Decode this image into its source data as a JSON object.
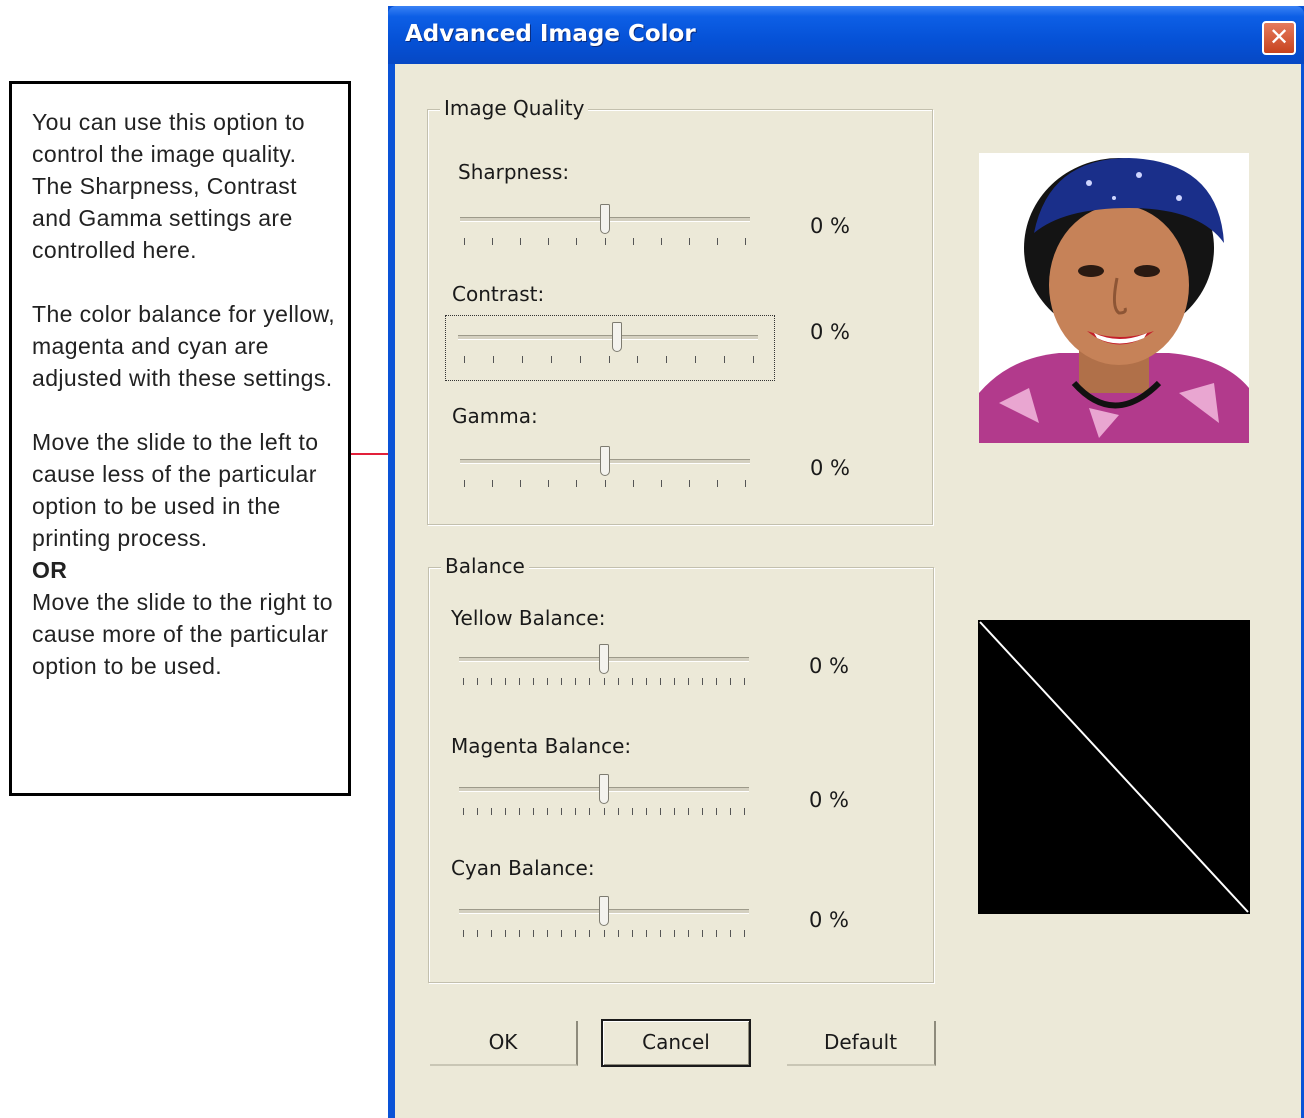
{
  "callout": {
    "para1": "You can use this option to control the image quality. The Sharpness, Contrast and Gamma settings are controlled here.",
    "para2": "The color balance for yellow, magenta and cyan are adjusted with these settings.",
    "para3": "Move the slide to the left to cause less of the particular option to be used in the printing process.",
    "or_label": "OR",
    "para4": "Move the slide to the right to cause more of the particular option to be used."
  },
  "dialog": {
    "title": "Advanced Image Color",
    "close_glyph": "✕"
  },
  "image_quality": {
    "legend": "Image Quality",
    "sharpness": {
      "label": "Sharpness:",
      "value": "0 %",
      "level": 0
    },
    "contrast": {
      "label": "Contrast:",
      "value": "0 %",
      "level": 0
    },
    "gamma": {
      "label": "Gamma:",
      "value": "0 %",
      "level": 0
    }
  },
  "balance": {
    "legend": "Balance",
    "yellow": {
      "label": "Yellow Balance:",
      "value": "0 %",
      "level": 0
    },
    "magenta": {
      "label": "Magenta Balance:",
      "value": "0 %",
      "level": 0
    },
    "cyan": {
      "label": "Cyan Balance:",
      "value": "0 %",
      "level": 0
    }
  },
  "buttons": {
    "ok": "OK",
    "cancel": "Cancel",
    "default": "Default"
  },
  "colors": {
    "titlebar": "#0551d6",
    "face": "#ece9d8",
    "close": "#c8431e",
    "connector": "#e2203a"
  }
}
